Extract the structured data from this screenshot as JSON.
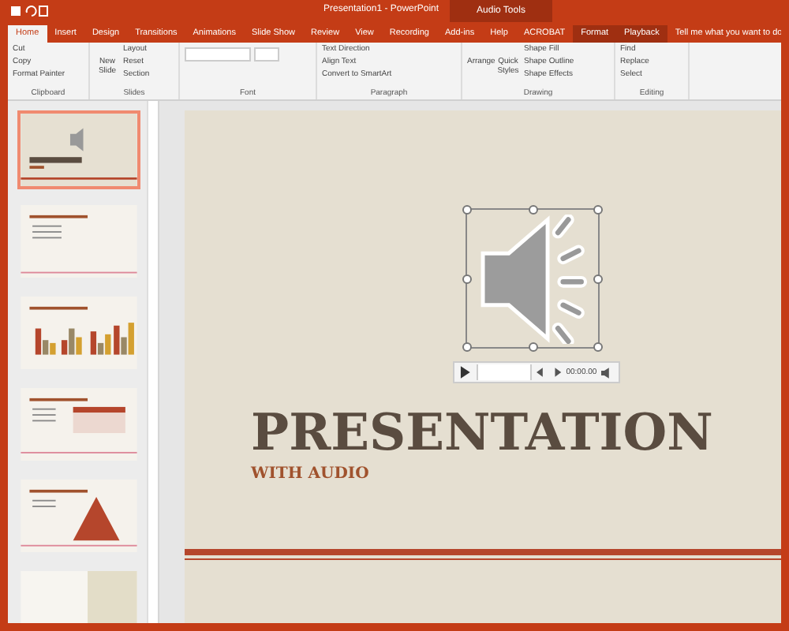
{
  "window": {
    "title": "Presentation1 - PowerPoint",
    "context_label": "Audio Tools"
  },
  "tabs": [
    {
      "label": "Home",
      "selected": true
    },
    {
      "label": "Insert",
      "selected": false
    },
    {
      "label": "Design",
      "selected": false
    },
    {
      "label": "Transitions",
      "selected": false
    },
    {
      "label": "Animations",
      "selected": false
    },
    {
      "label": "Slide Show",
      "selected": false
    },
    {
      "label": "Review",
      "selected": false
    },
    {
      "label": "View",
      "selected": false
    },
    {
      "label": "Recording",
      "selected": false
    },
    {
      "label": "Add-ins",
      "selected": false
    },
    {
      "label": "Help",
      "selected": false
    },
    {
      "label": "ACROBAT",
      "selected": false
    },
    {
      "label": "Format",
      "selected": false
    },
    {
      "label": "Playback",
      "selected": false
    }
  ],
  "tell_me": "Tell me what you want to do",
  "ribbon": [
    {
      "name": "Clipboard",
      "items": [
        "Cut",
        "Copy",
        "Format Painter"
      ]
    },
    {
      "name": "Slides",
      "big": "New Slide",
      "items": [
        "Layout",
        "Reset",
        "Section"
      ]
    },
    {
      "name": "Font"
    },
    {
      "name": "Paragraph",
      "items": [
        "Text Direction",
        "Align Text",
        "Convert to SmartArt"
      ]
    },
    {
      "name": "Drawing",
      "big": "Arrange",
      "big2": "Quick Styles",
      "items": [
        "Shape Fill",
        "Shape Outline",
        "Shape Effects"
      ]
    },
    {
      "name": "Editing",
      "items": [
        "Find",
        "Replace",
        "Select"
      ]
    }
  ],
  "thumbnails": [
    {
      "kind": "title",
      "selected": true
    },
    {
      "kind": "bullets",
      "selected": false
    },
    {
      "kind": "chart",
      "selected": false
    },
    {
      "kind": "table",
      "selected": false
    },
    {
      "kind": "pyramid",
      "selected": false
    },
    {
      "kind": "photo",
      "selected": false
    }
  ],
  "slide": {
    "title": "PRESENTATION",
    "subtitle": "WITH AUDIO"
  },
  "audio_player": {
    "time": "00:00.00"
  }
}
